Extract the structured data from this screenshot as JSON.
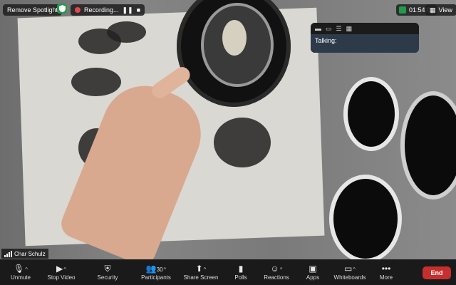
{
  "app": {
    "meeting": "Zoom"
  },
  "overlays": {
    "remove_spotlight": "Remove Spotlight",
    "recording_label": "Recording...",
    "pause_icon": "❚❚",
    "stop_icon": "■",
    "timer": "01:54:00",
    "view_label": "View",
    "talking_label": "Talking:"
  },
  "participant": {
    "name": "Char Schulz"
  },
  "toolbar": {
    "unmute": "Unmute",
    "stop_video": "Stop Video",
    "security": "Security",
    "participants": "Participants",
    "participants_count": "30",
    "share_screen": "Share Screen",
    "polls": "Polls",
    "reactions": "Reactions",
    "apps": "Apps",
    "whiteboards": "Whiteboards",
    "more": "More",
    "end": "End"
  },
  "colors": {
    "accent_green": "#2ed06a",
    "end_red": "#c72e2e",
    "toolbar_bg": "#1a1a1a"
  }
}
